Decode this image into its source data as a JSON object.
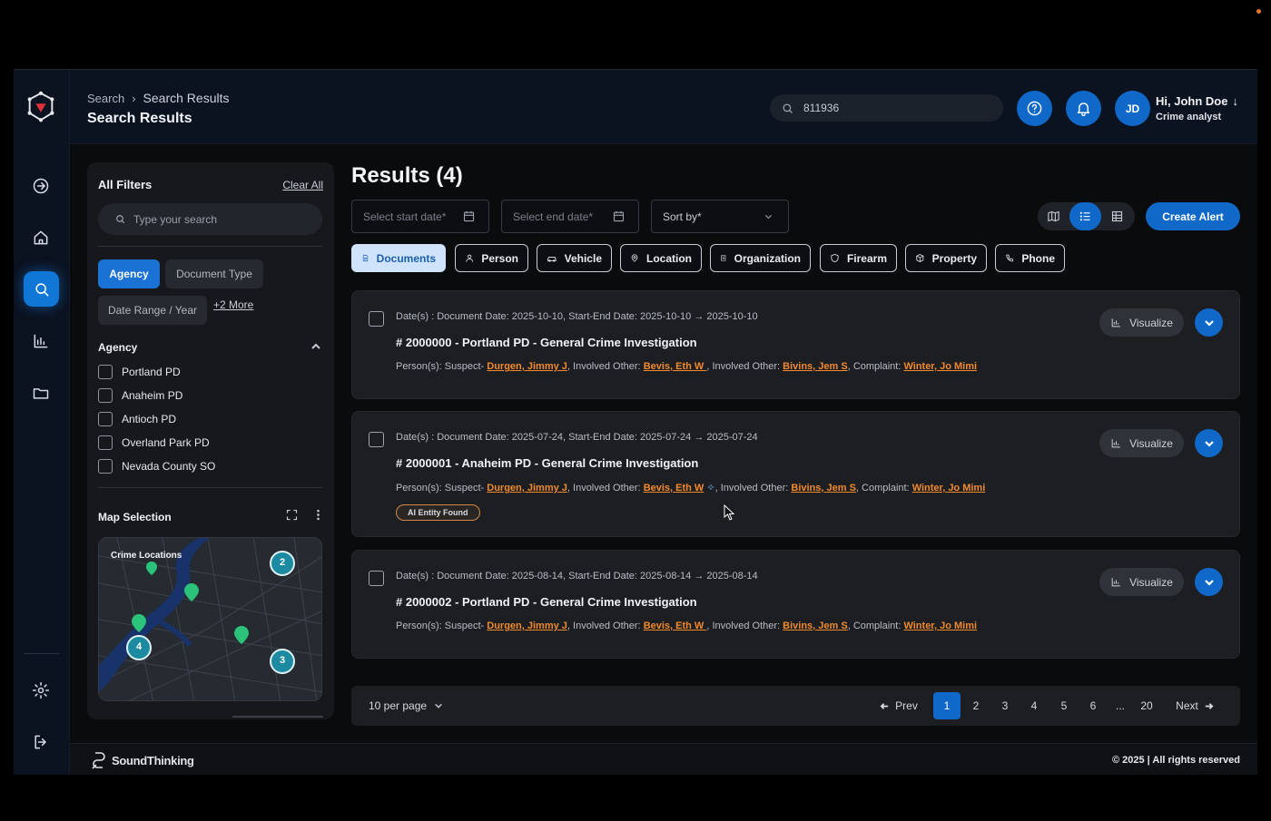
{
  "header": {
    "breadcrumb_root": "Search",
    "breadcrumb_current": "Search Results",
    "page_title": "Search Results",
    "search_value": "811936",
    "user_initials": "JD",
    "user_greeting": "Hi, John Doe",
    "user_role": "Crime analyst"
  },
  "filters": {
    "title": "All Filters",
    "clear_all": "Clear All",
    "search_placeholder": "Type your search",
    "chips": [
      "Agency",
      "Document Type",
      "Date Range / Year"
    ],
    "more": "+2 More",
    "agency_section": "Agency",
    "agencies": [
      "Portland PD",
      "Anaheim PD",
      "Antioch PD",
      "Overland Park PD",
      "Nevada County SO"
    ],
    "map_section": "Map Selection",
    "map_label": "Crime Locations",
    "clusters": [
      "2",
      "4",
      "3"
    ]
  },
  "results": {
    "title": "Results (4)",
    "start_date_placeholder": "Select start date*",
    "end_date_placeholder": "Select end date*",
    "sort_label": "Sort by*",
    "create_alert": "Create Alert",
    "tabs": [
      "Documents",
      "Person",
      "Vehicle",
      "Location",
      "Organization",
      "Firearm",
      "Property",
      "Phone"
    ],
    "visualize_label": "Visualize",
    "ai_badge": "AI Entity Found",
    "cards": [
      {
        "dates": "Date(s) : Document Date: 2025-10-10, Start-End Date: 2025-10-10 → 2025-10-10",
        "title": "# 2000000 - Portland PD - General Crime Investigation",
        "persons_prefix": "Person(s): Suspect-",
        "suspect": "Durgen, Jimmy J",
        "involved_label": ", Involved Other:",
        "involved1": "Bevis, Eth W ",
        "involved_label2": ", Involved Other:",
        "involved2": "Bivins, Jem S",
        "complaint_label": ", Complaint:",
        "complaint": "Winter, Jo Mimi"
      },
      {
        "dates": "Date(s) : Document Date: 2025-07-24, Start-End Date: 2025-07-24 → 2025-07-24",
        "title": "# 2000001 - Anaheim PD - General Crime Investigation",
        "persons_prefix": "Person(s): Suspect-",
        "suspect": "Durgen, Jimmy J",
        "involved_label": ", Involved Other:",
        "involved1": "Bevis, Eth W",
        "involved_label2": ", Involved Other:",
        "involved2": "Bivins, Jem S",
        "complaint_label": ", Complaint:",
        "complaint": "Winter, Jo Mimi"
      },
      {
        "dates": "Date(s) : Document Date: 2025-08-14, Start-End Date: 2025-08-14 → 2025-08-14",
        "title": "# 2000002 - Portland PD - General Crime Investigation",
        "persons_prefix": "Person(s): Suspect-",
        "suspect": "Durgen, Jimmy J",
        "involved_label": ", Involved Other:",
        "involved1": "Bevis, Eth W ",
        "involved_label2": ", Involved Other:",
        "involved2": "Bivins, Jem S",
        "complaint_label": ", Complaint:",
        "complaint": "Winter, Jo Mimi"
      }
    ]
  },
  "pagination": {
    "per_page": "10 per page",
    "prev": "Prev",
    "next": "Next",
    "pages": [
      "1",
      "2",
      "3",
      "4",
      "5",
      "6",
      "...",
      "20"
    ],
    "current": "1"
  },
  "footer": {
    "brand": "SoundThinking",
    "copyright": "© 2025 | All rights reserved"
  },
  "colors": {
    "accent": "#1069c8",
    "link": "#f28a2e",
    "active_tab_bg": "#cfe3fa"
  }
}
